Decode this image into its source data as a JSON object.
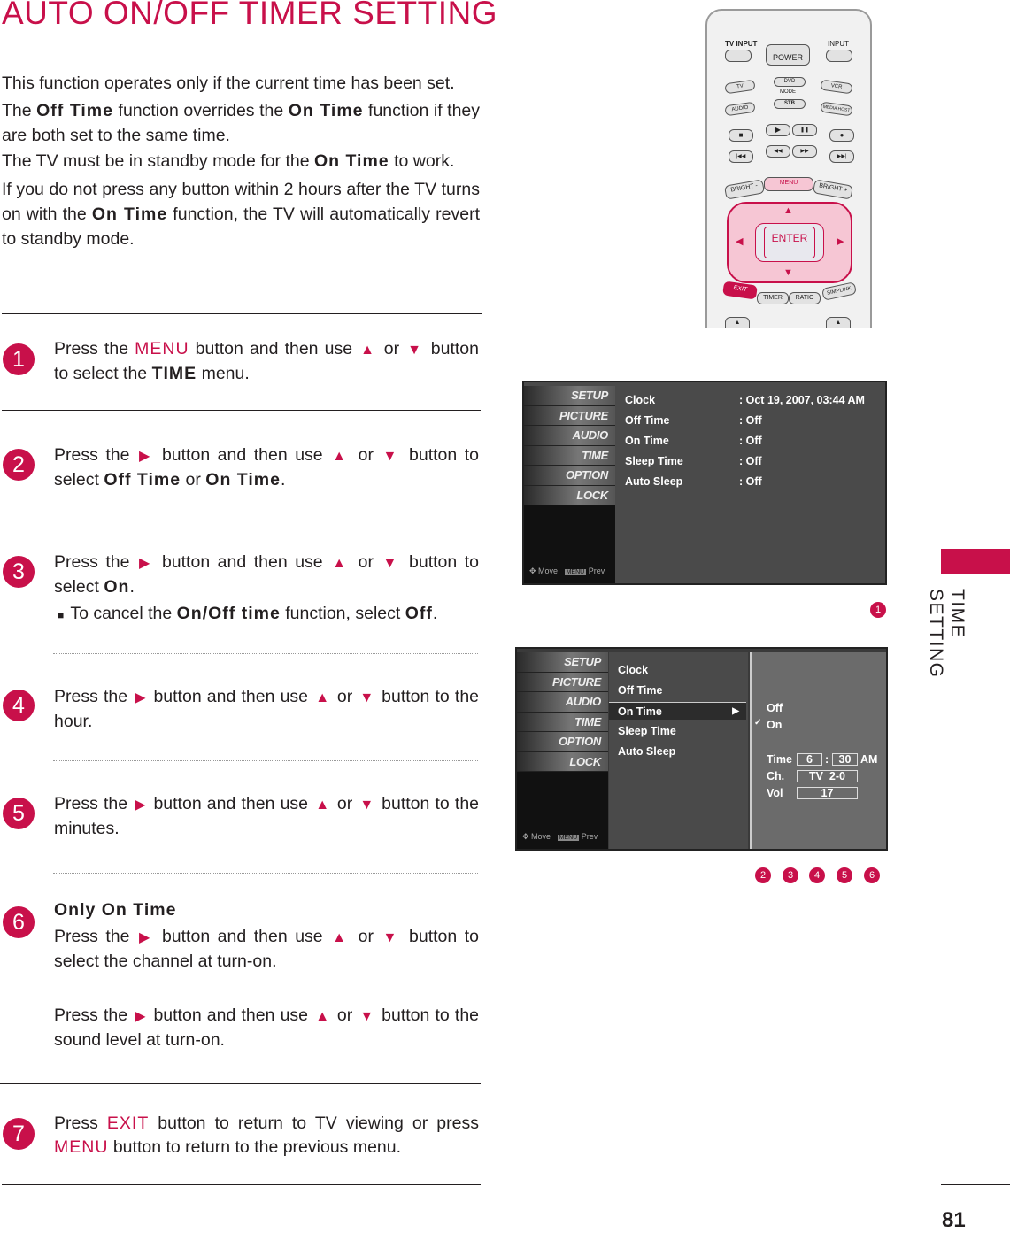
{
  "title": "AUTO ON/OFF TIMER SETTING",
  "intro": [
    [
      {
        "t": "This function operates only if the current time has been set."
      }
    ],
    [
      {
        "t": "The "
      },
      {
        "t": "Off Time",
        "s": "k"
      },
      {
        "t": " function overrides the "
      },
      {
        "t": "On Time",
        "s": "k"
      },
      {
        "t": " function if they are both set to the same time."
      }
    ],
    [
      {
        "t": "The TV must be in standby mode for the "
      },
      {
        "t": "On Time",
        "s": "k"
      },
      {
        "t": " to work."
      }
    ],
    [
      {
        "t": "If you do not press any button within 2 hours after the TV turns on with the "
      },
      {
        "t": "On Time",
        "s": "k"
      },
      {
        "t": " function, the TV will automati­cally revert to standby mode."
      }
    ]
  ],
  "icons": {
    "up": "▲",
    "down": "▼",
    "right": "▶",
    "bullet": "■",
    "check": "✓"
  },
  "steps": [
    {
      "num": "1",
      "paras": [
        [
          {
            "t": "Press the "
          },
          {
            "t": "MENU",
            "s": "r"
          },
          {
            "t": " button and then use "
          },
          {
            "i": "up"
          },
          {
            "t": " or "
          },
          {
            "i": "down"
          },
          {
            "t": " button to select the "
          },
          {
            "t": "TIME",
            "s": "k"
          },
          {
            "t": " menu."
          }
        ]
      ]
    },
    {
      "num": "2",
      "paras": [
        [
          {
            "t": "Press the "
          },
          {
            "i": "right"
          },
          {
            "t": " button and then use "
          },
          {
            "i": "up"
          },
          {
            "t": " or "
          },
          {
            "i": "down"
          },
          {
            "t": " button to select "
          },
          {
            "t": "Off Time",
            "s": "k"
          },
          {
            "t": " or "
          },
          {
            "t": "On Time",
            "s": "k"
          },
          {
            "t": "."
          }
        ]
      ]
    },
    {
      "num": "3",
      "paras": [
        [
          {
            "t": "Press the "
          },
          {
            "i": "right"
          },
          {
            "t": " button and then use "
          },
          {
            "i": "up"
          },
          {
            "t": " or "
          },
          {
            "i": "down"
          },
          {
            "t": " button to select "
          },
          {
            "t": "On",
            "s": "k"
          },
          {
            "t": "."
          }
        ],
        [
          {
            "i": "bullet"
          },
          {
            "t": " To cancel the "
          },
          {
            "t": "On/Off time",
            "s": "k"
          },
          {
            "t": " function, select "
          },
          {
            "t": "Off",
            "s": "k"
          },
          {
            "t": "."
          }
        ]
      ]
    },
    {
      "num": "4",
      "paras": [
        [
          {
            "t": "Press the "
          },
          {
            "i": "right"
          },
          {
            "t": " button and then use "
          },
          {
            "i": "up"
          },
          {
            "t": " or "
          },
          {
            "i": "down"
          },
          {
            "t": " button to the hour."
          }
        ]
      ]
    },
    {
      "num": "5",
      "paras": [
        [
          {
            "t": "Press the "
          },
          {
            "i": "right"
          },
          {
            "t": " button and then use "
          },
          {
            "i": "up"
          },
          {
            "t": " or "
          },
          {
            "i": "down"
          },
          {
            "t": " button to the minutes."
          }
        ]
      ]
    },
    {
      "num": "6",
      "paras": [
        [
          {
            "t": "Only On Time",
            "s": "k"
          }
        ],
        [
          {
            "t": "Press the "
          },
          {
            "i": "right"
          },
          {
            "t": " button and then use "
          },
          {
            "i": "up"
          },
          {
            "t": " or "
          },
          {
            "i": "down"
          },
          {
            "t": " button to select the channel at turn-on."
          }
        ],
        [
          {
            "t": "Press the "
          },
          {
            "i": "right"
          },
          {
            "t": " button and then use "
          },
          {
            "i": "up"
          },
          {
            "t": " or "
          },
          {
            "i": "down"
          },
          {
            "t": " button to the sound level at turn-on."
          }
        ]
      ]
    },
    {
      "num": "7",
      "paras": [
        [
          {
            "t": "Press "
          },
          {
            "t": "EXIT",
            "s": "r"
          },
          {
            "t": " button to return to TV viewing or press "
          },
          {
            "t": "MENU",
            "s": "r"
          },
          {
            "t": " button to return to the previous menu."
          }
        ]
      ]
    }
  ],
  "remote": {
    "tv_input": "TV INPUT",
    "power": "POWER",
    "input": "INPUT",
    "tv": "TV",
    "dvd": "DVD",
    "vcr": "VCR",
    "mode": "MODE",
    "audio": "AUDIO",
    "stb": "STB",
    "media_host": "MEDIA HOST",
    "stop": "■",
    "play": "▶",
    "pause": "❚❚",
    "rec": "●",
    "prev": "|◀◀",
    "rew": "◀◀",
    "ff": "▶▶",
    "next": "▶▶|",
    "bright_minus": "BRIGHT -",
    "menu": "MENU",
    "bright_plus": "BRIGHT +",
    "enter": "ENTER",
    "exit": "EXIT",
    "timer": "TIMER",
    "ratio": "RATIO",
    "simplink": "SIMPLINK"
  },
  "osd_sidebar": [
    "SETUP",
    "PICTURE",
    "AUDIO",
    "TIME",
    "OPTION",
    "LOCK"
  ],
  "osd_footer": {
    "move": "Move",
    "menu_key": "MENU",
    "prev": "Prev"
  },
  "screen1": {
    "rows": [
      {
        "label": "Clock",
        "value": ": Oct 19, 2007, 03:44 AM"
      },
      {
        "label": "Off Time",
        "value": ": Off"
      },
      {
        "label": "On Time",
        "value": ": Off"
      },
      {
        "label": "Sleep Time",
        "value": ": Off"
      },
      {
        "label": "Auto Sleep",
        "value": ": Off"
      }
    ],
    "badge": "1"
  },
  "screen2": {
    "items": [
      "Clock",
      "Off Time",
      "On Time",
      "Sleep Time",
      "Auto Sleep"
    ],
    "selected": "On Time",
    "options": [
      "Off",
      "On"
    ],
    "checked": "On",
    "time_label": "Time",
    "hour": "6",
    "sep": ":",
    "minute": "30",
    "ampm": "AM",
    "ch_label": "Ch.",
    "ch_value": "TV  2-0",
    "vol_label": "Vol",
    "vol_value": "17",
    "badges": [
      "2",
      "3",
      "4",
      "5",
      "6"
    ]
  },
  "side_label": "TIME SETTING",
  "page_number": "81",
  "colors": {
    "accent": "#c8104a",
    "osd_bg": "#3a3a3a"
  }
}
